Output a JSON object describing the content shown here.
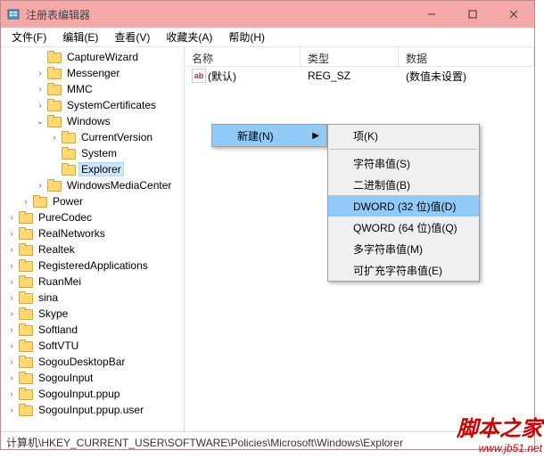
{
  "window": {
    "title": "注册表编辑器"
  },
  "winbtns": {
    "min": "minimize",
    "max": "maximize",
    "close": "close"
  },
  "menu": {
    "file": "文件(F)",
    "edit": "编辑(E)",
    "view": "查看(V)",
    "favorites": "收藏夹(A)",
    "help": "帮助(H)"
  },
  "tree": [
    {
      "indent": 2,
      "tog": "",
      "label": "CaptureWizard"
    },
    {
      "indent": 2,
      "tog": "›",
      "label": "Messenger"
    },
    {
      "indent": 2,
      "tog": "›",
      "label": "MMC"
    },
    {
      "indent": 2,
      "tog": "›",
      "label": "SystemCertificates"
    },
    {
      "indent": 2,
      "tog": "⌄",
      "label": "Windows"
    },
    {
      "indent": 3,
      "tog": "›",
      "label": "CurrentVersion"
    },
    {
      "indent": 3,
      "tog": "",
      "label": "System"
    },
    {
      "indent": 3,
      "tog": "",
      "label": "Explorer",
      "sel": true
    },
    {
      "indent": 2,
      "tog": "›",
      "label": "WindowsMediaCenter"
    },
    {
      "indent": 1,
      "tog": "›",
      "label": "Power"
    },
    {
      "indent": 0,
      "tog": "›",
      "label": "PureCodec"
    },
    {
      "indent": 0,
      "tog": "›",
      "label": "RealNetworks"
    },
    {
      "indent": 0,
      "tog": "›",
      "label": "Realtek"
    },
    {
      "indent": 0,
      "tog": "›",
      "label": "RegisteredApplications"
    },
    {
      "indent": 0,
      "tog": "›",
      "label": "RuanMei"
    },
    {
      "indent": 0,
      "tog": "›",
      "label": "sina"
    },
    {
      "indent": 0,
      "tog": "›",
      "label": "Skype"
    },
    {
      "indent": 0,
      "tog": "›",
      "label": "Softland"
    },
    {
      "indent": 0,
      "tog": "›",
      "label": "SoftVTU"
    },
    {
      "indent": 0,
      "tog": "›",
      "label": "SogouDesktopBar"
    },
    {
      "indent": 0,
      "tog": "›",
      "label": "SogouInput"
    },
    {
      "indent": 0,
      "tog": "›",
      "label": "SogouInput.ppup"
    },
    {
      "indent": 0,
      "tog": "›",
      "label": "SogouInput.ppup.user"
    }
  ],
  "list": {
    "columns": {
      "name": "名称",
      "type": "类型",
      "data": "数据"
    },
    "rows": [
      {
        "name": "(默认)",
        "type": "REG_SZ",
        "data": "(数值未设置)"
      }
    ]
  },
  "context": {
    "new": "新建(N)",
    "sub": {
      "key": "项(K)",
      "string": "字符串值(S)",
      "binary": "二进制值(B)",
      "dword": "DWORD (32 位)值(D)",
      "qword": "QWORD (64 位)值(Q)",
      "multi": "多字符串值(M)",
      "expand": "可扩充字符串值(E)"
    }
  },
  "statusbar": "计算机\\HKEY_CURRENT_USER\\SOFTWARE\\Policies\\Microsoft\\Windows\\Explorer",
  "watermark": {
    "cn": "脚本之家",
    "url": "www.jb51.net"
  }
}
